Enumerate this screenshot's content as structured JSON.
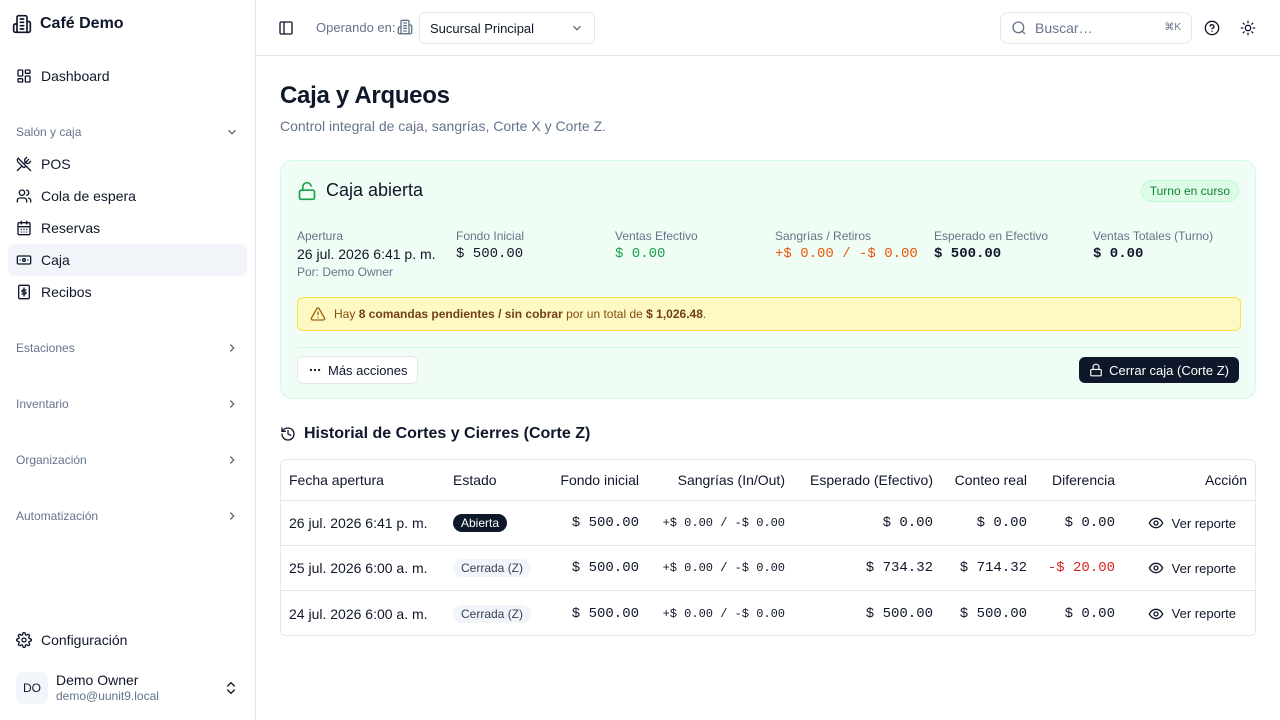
{
  "sidebar": {
    "brand": "Café Demo",
    "dashboard": "Dashboard",
    "group_salon": "Salón y caja",
    "items": [
      "POS",
      "Cola de espera",
      "Reservas",
      "Caja",
      "Recibos"
    ],
    "groups": [
      "Estaciones",
      "Inventario",
      "Organización",
      "Automatización"
    ],
    "settings": "Configuración",
    "user": {
      "initials": "DO",
      "name": "Demo Owner",
      "email": "demo@uunit9.local"
    }
  },
  "topbar": {
    "operating_label": "Operando en:",
    "branch": "Sucursal Principal",
    "search_placeholder": "Buscar…",
    "shortcut": "⌘K"
  },
  "page": {
    "title": "Caja y Arqueos",
    "subtitle": "Control integral de caja, sangrías, Corte X y Corte Z."
  },
  "cash_card": {
    "title": "Caja abierta",
    "badge": "Turno en curso",
    "opening_label": "Apertura",
    "opening_value": "26 jul. 2026 6:41 p. m.",
    "opening_by": "Por: Demo Owner",
    "initial_fund_label": "Fondo Inicial",
    "initial_fund_value": "$ 500.00",
    "cash_sales_label": "Ventas Efectivo",
    "cash_sales_value": "$ 0.00",
    "withdrawals_label": "Sangrías / Retiros",
    "withdrawals_value": "+$ 0.00 / -$ 0.00",
    "expected_label": "Esperado en Efectivo",
    "expected_value": "$ 500.00",
    "total_sales_label": "Ventas Totales (Turno)",
    "total_sales_value": "$ 0.00",
    "alert_pre": "Hay ",
    "alert_bold1": "8 comandas pendientes / sin cobrar",
    "alert_mid": " por un total de ",
    "alert_bold2": "$ 1,026.48",
    "alert_post": ".",
    "more_actions": "Más acciones",
    "close_button": "Cerrar caja (Corte Z)"
  },
  "history": {
    "title": "Historial de Cortes y Cierres (Corte Z)",
    "columns": [
      "Fecha apertura",
      "Estado",
      "Fondo inicial",
      "Sangrías (In/Out)",
      "Esperado (Efectivo)",
      "Conteo real",
      "Diferencia",
      "Acción"
    ],
    "rows": [
      {
        "date": "26 jul. 2026 6:41 p. m.",
        "status": "Abierta",
        "fund": "$ 500.00",
        "sangrias": "+$ 0.00 / -$ 0.00",
        "expected": "$ 0.00",
        "counted": "$ 0.00",
        "diff": "$ 0.00",
        "action": "Ver reporte"
      },
      {
        "date": "25 jul. 2026 6:00 a. m.",
        "status": "Cerrada (Z)",
        "fund": "$ 500.00",
        "sangrias": "+$ 0.00 / -$ 0.00",
        "expected": "$ 734.32",
        "counted": "$ 714.32",
        "diff": "-$ 20.00",
        "action": "Ver reporte"
      },
      {
        "date": "24 jul. 2026 6:00 a. m.",
        "status": "Cerrada (Z)",
        "fund": "$ 500.00",
        "sangrias": "+$ 0.00 / -$ 0.00",
        "expected": "$ 500.00",
        "counted": "$ 500.00",
        "diff": "$ 0.00",
        "action": "Ver reporte"
      }
    ]
  },
  "colors": {
    "accent_dark": "#0f172a",
    "success": "#16a34a",
    "warning": "#ea580c",
    "danger": "#dc2626"
  }
}
